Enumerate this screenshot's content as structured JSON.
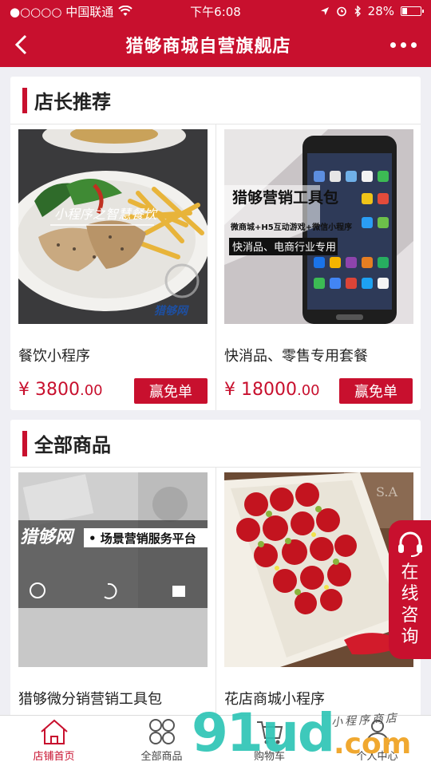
{
  "status": {
    "carrier": "●○○○○ 中国联通",
    "time": "下午6:08",
    "battery_text": "28%",
    "battery_level": 0.28
  },
  "nav": {
    "title": "猎够商城自营旗舰店"
  },
  "recommend": {
    "title": "店长推荐",
    "items": [
      {
        "name": "餐饮小程序",
        "currency": "¥",
        "price_int": "3800",
        "price_dec": ".00",
        "button": "赢免单",
        "img_caption": "小程序之智慧餐饮"
      },
      {
        "name": "快消品、零售专用套餐",
        "currency": "¥",
        "price_int": "18000",
        "price_dec": ".00",
        "button": "赢免单",
        "img_title": "猎够营销工具包",
        "img_sub1": "微商城+H5互动游戏+微信小程序",
        "img_sub2": "快消品、电商行业专用"
      }
    ]
  },
  "all": {
    "title": "全部商品",
    "items": [
      {
        "name": "猎够微分销营销工具包",
        "img_brand": "猎够网",
        "img_slogan": "• 场景营销服务平台"
      },
      {
        "name": "花店商城小程序"
      }
    ]
  },
  "consult": {
    "label": "在线咨询"
  },
  "tabs": [
    {
      "label": "店铺首页",
      "icon": "home-icon",
      "active": true
    },
    {
      "label": "全部商品",
      "icon": "grid-icon",
      "active": false
    },
    {
      "label": "购物车",
      "icon": "cart-icon",
      "active": false
    },
    {
      "label": "个人中心",
      "icon": "user-icon",
      "active": false
    }
  ],
  "watermark": {
    "big": "91ud",
    "com": ".com",
    "hand": "小程序商店"
  },
  "colors": {
    "brand": "#c8102e",
    "background": "#efeff4"
  }
}
